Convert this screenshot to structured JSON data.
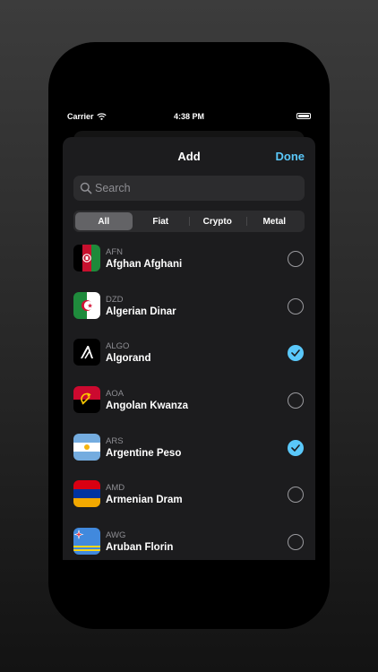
{
  "status_bar": {
    "carrier": "Carrier",
    "time": "4:38 PM"
  },
  "sheet": {
    "title": "Add",
    "done_label": "Done"
  },
  "search": {
    "placeholder": "Search"
  },
  "filters": [
    {
      "label": "All",
      "selected": true
    },
    {
      "label": "Fiat",
      "selected": false
    },
    {
      "label": "Crypto",
      "selected": false
    },
    {
      "label": "Metal",
      "selected": false
    }
  ],
  "currencies": [
    {
      "code": "AFN",
      "name": "Afghan Afghani",
      "flag": "afghanistan-flag",
      "checked": false
    },
    {
      "code": "DZD",
      "name": "Algerian Dinar",
      "flag": "algeria-flag",
      "checked": false
    },
    {
      "code": "ALGO",
      "name": "Algorand",
      "flag": "algorand-logo",
      "checked": true
    },
    {
      "code": "AOA",
      "name": "Angolan Kwanza",
      "flag": "angola-flag",
      "checked": false
    },
    {
      "code": "ARS",
      "name": "Argentine Peso",
      "flag": "argentina-flag",
      "checked": true
    },
    {
      "code": "AMD",
      "name": "Armenian Dram",
      "flag": "armenia-flag",
      "checked": false
    },
    {
      "code": "AWG",
      "name": "Aruban Florin",
      "flag": "aruba-flag",
      "checked": false
    }
  ],
  "colors": {
    "accent": "#5ac8fa",
    "sheet_bg": "#1c1c1e",
    "field_bg": "#2c2c2e",
    "secondary_text": "#8e8e93"
  }
}
